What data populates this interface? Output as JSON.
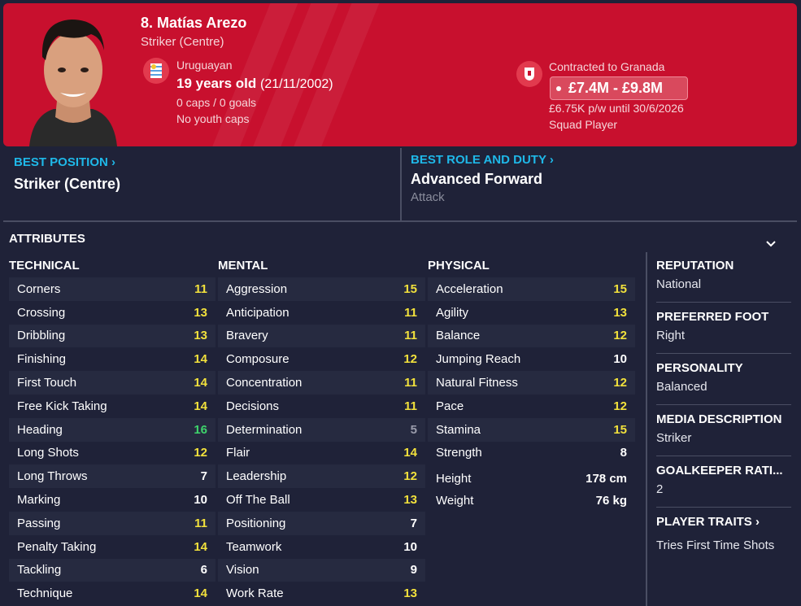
{
  "player": {
    "name": "8. Matías Arezo",
    "position": "Striker (Centre)",
    "nationality": "Uruguayan",
    "age_text": "19 years old",
    "dob": "(21/11/2002)",
    "caps": "0 caps / 0 goals",
    "youth_caps": "No youth caps",
    "contracted": "Contracted to Granada",
    "value": "£7.4M - £9.8M",
    "wage": "£6.75K p/w until 30/6/2026",
    "squad_status": "Squad Player"
  },
  "best_position": {
    "label": "BEST POSITION",
    "value": "Striker (Centre)"
  },
  "best_role": {
    "label": "BEST ROLE AND DUTY",
    "value": "Advanced Forward",
    "duty": "Attack"
  },
  "attributes_title": "ATTRIBUTES",
  "technical": {
    "title": "TECHNICAL",
    "items": [
      {
        "name": "Corners",
        "value": "11"
      },
      {
        "name": "Crossing",
        "value": "13"
      },
      {
        "name": "Dribbling",
        "value": "13"
      },
      {
        "name": "Finishing",
        "value": "14"
      },
      {
        "name": "First Touch",
        "value": "14"
      },
      {
        "name": "Free Kick Taking",
        "value": "14"
      },
      {
        "name": "Heading",
        "value": "16"
      },
      {
        "name": "Long Shots",
        "value": "12"
      },
      {
        "name": "Long Throws",
        "value": "7"
      },
      {
        "name": "Marking",
        "value": "10"
      },
      {
        "name": "Passing",
        "value": "11"
      },
      {
        "name": "Penalty Taking",
        "value": "14"
      },
      {
        "name": "Tackling",
        "value": "6"
      },
      {
        "name": "Technique",
        "value": "14"
      }
    ]
  },
  "mental": {
    "title": "MENTAL",
    "items": [
      {
        "name": "Aggression",
        "value": "15"
      },
      {
        "name": "Anticipation",
        "value": "11"
      },
      {
        "name": "Bravery",
        "value": "11"
      },
      {
        "name": "Composure",
        "value": "12"
      },
      {
        "name": "Concentration",
        "value": "11"
      },
      {
        "name": "Decisions",
        "value": "11"
      },
      {
        "name": "Determination",
        "value": "5"
      },
      {
        "name": "Flair",
        "value": "14"
      },
      {
        "name": "Leadership",
        "value": "12"
      },
      {
        "name": "Off The Ball",
        "value": "13"
      },
      {
        "name": "Positioning",
        "value": "7"
      },
      {
        "name": "Teamwork",
        "value": "10"
      },
      {
        "name": "Vision",
        "value": "9"
      },
      {
        "name": "Work Rate",
        "value": "13"
      }
    ]
  },
  "physical": {
    "title": "PHYSICAL",
    "items": [
      {
        "name": "Acceleration",
        "value": "15"
      },
      {
        "name": "Agility",
        "value": "13"
      },
      {
        "name": "Balance",
        "value": "12"
      },
      {
        "name": "Jumping Reach",
        "value": "10"
      },
      {
        "name": "Natural Fitness",
        "value": "12"
      },
      {
        "name": "Pace",
        "value": "12"
      },
      {
        "name": "Stamina",
        "value": "15"
      },
      {
        "name": "Strength",
        "value": "8"
      }
    ],
    "height_label": "Height",
    "height": "178 cm",
    "weight_label": "Weight",
    "weight": "76 kg"
  },
  "side": {
    "reputation_label": "REPUTATION",
    "reputation": "National",
    "foot_label": "PREFERRED FOOT",
    "foot": "Right",
    "personality_label": "PERSONALITY",
    "personality": "Balanced",
    "media_label": "MEDIA DESCRIPTION",
    "media": "Striker",
    "gk_label": "GOALKEEPER RATI...",
    "gk": "2",
    "traits_label": "PLAYER TRAITS",
    "traits": "Tries First Time Shots"
  },
  "colors": {
    "header": "#c8102e",
    "bg": "#1f2238",
    "link": "#1fb8e8",
    "yellow": "#f2e13c",
    "green": "#3ed46b"
  }
}
